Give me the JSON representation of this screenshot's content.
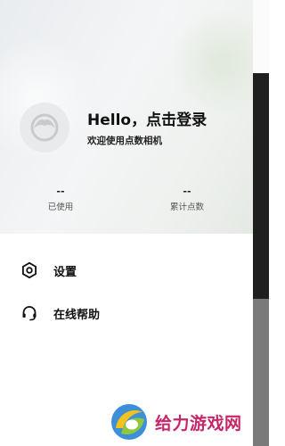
{
  "header": {
    "greeting": "Hello，点击登录",
    "subtitle": "欢迎使用点数相机",
    "avatar_icon": "default-avatar-icon"
  },
  "stats": [
    {
      "value": "--",
      "label": "已使用"
    },
    {
      "value": "--",
      "label": "累计点数"
    }
  ],
  "menu": {
    "items": [
      {
        "label": "设置",
        "icon": "settings-icon"
      },
      {
        "label": "在线帮助",
        "icon": "headset-icon"
      }
    ]
  },
  "watermark": {
    "text": "给力游戏网",
    "color": "#c6266a"
  }
}
